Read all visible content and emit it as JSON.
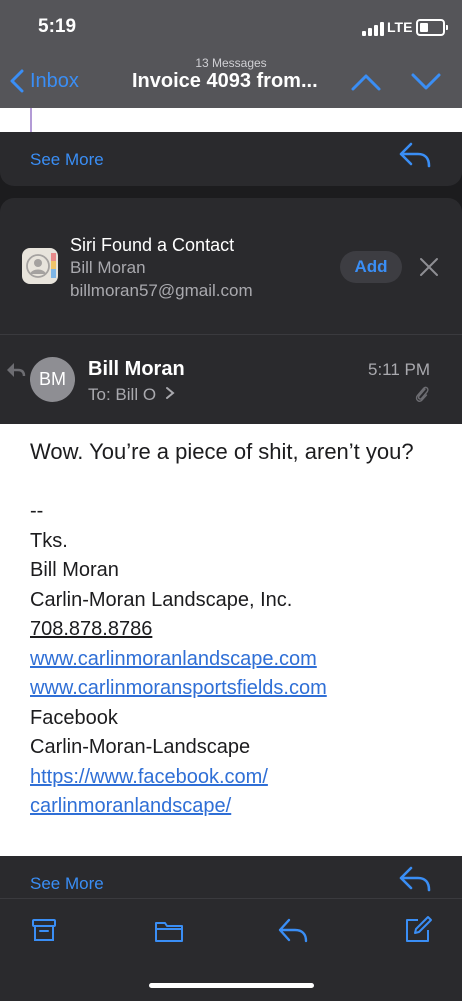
{
  "status_bar": {
    "time": "5:19",
    "network": "LTE",
    "signal_icon": "signal-bars-icon",
    "battery_icon": "battery-icon"
  },
  "nav": {
    "back_label": "Inbox",
    "message_count": "13 Messages",
    "title": "Invoice 4093 from...",
    "up_icon": "chevron-up-icon",
    "down_icon": "chevron-down-icon"
  },
  "previous_message": {
    "see_more": "See More",
    "reply_icon": "reply-icon"
  },
  "siri_suggestion": {
    "title": "Siri Found a Contact",
    "name": "Bill Moran",
    "email": "billmoran57@gmail.com",
    "add_label": "Add",
    "contact_icon": "contacts-icon",
    "close_icon": "close-icon"
  },
  "message": {
    "avatar_initials": "BM",
    "sender": "Bill Moran",
    "to_label": "To:",
    "to_value": "Bill O",
    "time": "5:11 PM",
    "attachment_icon": "paperclip-icon",
    "body": "Wow. You’re a piece of shit, aren’t you?",
    "signature": {
      "separator": "--",
      "thanks": "Tks.",
      "name": "Bill Moran",
      "company": "Carlin-Moran Landscape, Inc.",
      "phone": "708.878.8786",
      "website1": "www.carlinmoranlandscape.com",
      "website2": "www.carlinmoransportsfields.com",
      "facebook_label": "Facebook",
      "facebook_page": "Carlin-Moran-Landscape",
      "facebook_url_line1": "https://www.facebook.com/",
      "facebook_url_line2": "carlinmoranlandscape/"
    }
  },
  "bottom_card": {
    "see_more": "See More",
    "reply_icon": "reply-icon"
  },
  "toolbar": {
    "archive_icon": "archive-icon",
    "folder_icon": "folder-icon",
    "reply_icon": "reply-icon",
    "compose_icon": "compose-icon"
  },
  "colors": {
    "accent": "#3a8ef5",
    "link": "#2f6fd6",
    "card": "#2a2a2d",
    "background": "#1c1c1e"
  }
}
